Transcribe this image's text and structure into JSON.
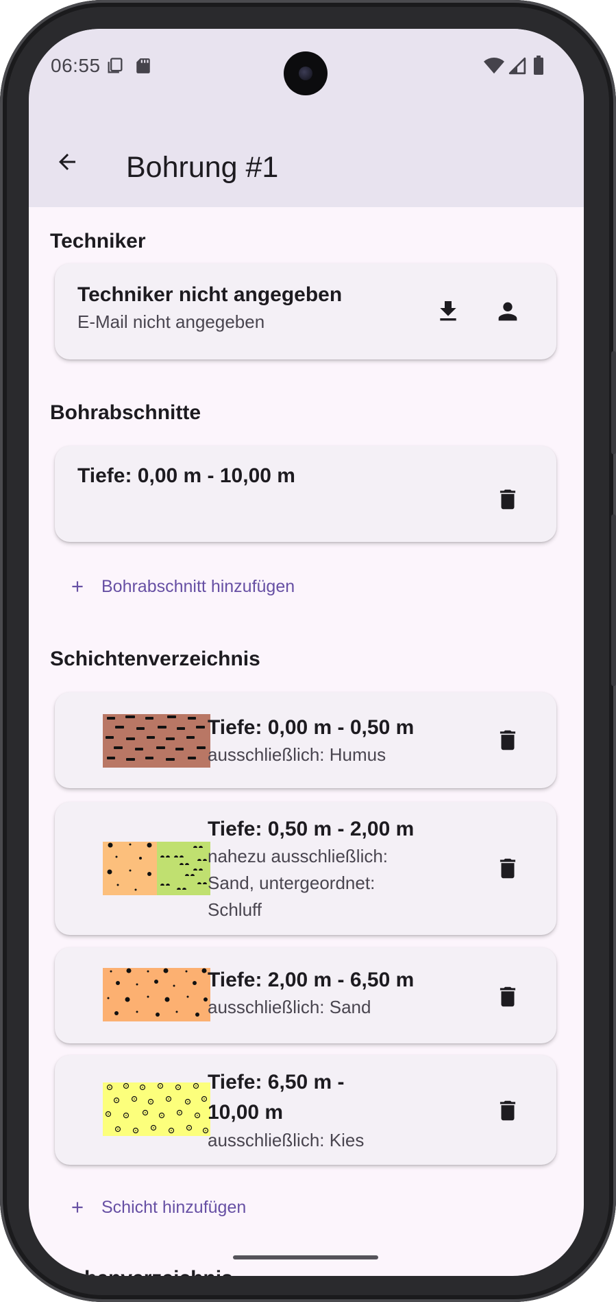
{
  "status_bar": {
    "time": "06:55",
    "left_icons": [
      "screen-record-icon",
      "sd-card-icon"
    ],
    "right_icons": [
      "wifi-icon",
      "signal-icon",
      "battery-icon"
    ]
  },
  "app_bar": {
    "title": "Bohrung #1",
    "back_icon": "arrow-back-icon"
  },
  "techniker": {
    "section_title": "Techniker",
    "name": "Techniker nicht angegeben",
    "email": "E-Mail nicht angegeben",
    "actions": [
      "download-icon",
      "person-icon"
    ]
  },
  "bohrabschnitte": {
    "section_title": "Bohrabschnitte",
    "items": [
      {
        "depth": "Tiefe: 0,00 m - 10,00 m"
      }
    ],
    "add_label": "Bohrabschnitt hinzufügen"
  },
  "schichtenverzeichnis": {
    "section_title": "Schichtenverzeichnis",
    "layers": [
      {
        "depth": "Tiefe: 0,00 m - 0,50 m",
        "desc": "ausschließlich: Humus",
        "pattern": "humus",
        "color": "#b97765"
      },
      {
        "depth": "Tiefe: 0,50 m - 2,00 m",
        "desc": "nahezu ausschließlich: Sand, untergeordnet: Schluff",
        "pattern": "sand-schluff",
        "color": "#fcbf7c"
      },
      {
        "depth": "Tiefe: 2,00 m - 6,50 m",
        "desc": "ausschließlich: Sand",
        "pattern": "sand",
        "color": "#fcb071"
      },
      {
        "depth": "Tiefe: 6,50 m - 10,00 m",
        "desc": "ausschließlich: Kies",
        "pattern": "kies",
        "color": "#fcff7c"
      }
    ],
    "add_label": "Schicht hinzufügen"
  },
  "probenverzeichnis": {
    "section_title": "Probenverzeichnis"
  },
  "colors": {
    "accent": "#6750a4",
    "appbar_bg": "#e8e3ef",
    "card_bg": "#f4f0f6",
    "page_bg": "#fcf5fc",
    "schluff_green": "#c0e070"
  }
}
